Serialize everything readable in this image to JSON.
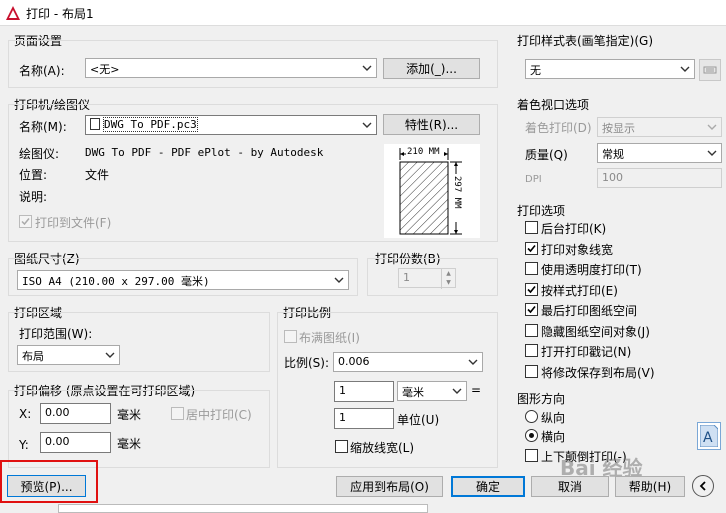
{
  "window": {
    "title": "打印 - 布局1"
  },
  "page_setup": {
    "group_label": "页面设置",
    "name_label": "名称(A):",
    "name_value": "<无>",
    "add_button": "添加(_)..."
  },
  "printer": {
    "group_label": "打印机/绘图仪",
    "name_label": "名称(M):",
    "name_value": "DWG To PDF.pc3",
    "properties_button": "特性(R)...",
    "plotter_label": "绘图仪:",
    "plotter_value": "DWG To PDF - PDF ePlot - by Autodesk",
    "location_label": "位置:",
    "location_value": "文件",
    "description_label": "说明:",
    "print_to_file": "打印到文件(F)",
    "paper_width": "210 MM",
    "paper_height": "297 MM"
  },
  "paper_size": {
    "group_label": "图纸尺寸(Z)",
    "value": "ISO A4 (210.00 x 297.00 毫米)"
  },
  "copies": {
    "group_label": "打印份数(B)",
    "value": "1"
  },
  "plot_area": {
    "group_label": "打印区域",
    "range_label": "打印范围(W):",
    "range_value": "布局"
  },
  "plot_offset": {
    "group_label": "打印偏移 (原点设置在可打印区域)",
    "x_label": "X:",
    "x_value": "0.00",
    "x_unit": "毫米",
    "y_label": "Y:",
    "y_value": "0.00",
    "y_unit": "毫米",
    "center_plot": "居中打印(C)"
  },
  "plot_scale": {
    "group_label": "打印比例",
    "fit_paper": "布满图纸(I)",
    "scale_label": "比例(S):",
    "scale_value": "0.006",
    "value1": "1",
    "unit_value": "毫米",
    "equals": "=",
    "value2": "1",
    "unit_label": "单位(U)",
    "scale_lineweights": "缩放线宽(L)"
  },
  "plot_style_table": {
    "group_label": "打印样式表(画笔指定)(G)",
    "value": "无"
  },
  "shaded_viewport": {
    "group_label": "着色视口选项",
    "shade_plot_label": "着色打印(D)",
    "shade_plot_value": "按显示",
    "quality_label": "质量(Q)",
    "quality_value": "常规",
    "dpi_label": "DPI",
    "dpi_value": "100"
  },
  "plot_options": {
    "group_label": "打印选项",
    "items": [
      {
        "label": "后台打印(K)",
        "checked": false
      },
      {
        "label": "打印对象线宽",
        "checked": true
      },
      {
        "label": "使用透明度打印(T)",
        "checked": false
      },
      {
        "label": "按样式打印(E)",
        "checked": true
      },
      {
        "label": "最后打印图纸空间",
        "checked": true
      },
      {
        "label": "隐藏图纸空间对象(J)",
        "checked": false
      },
      {
        "label": "打开打印戳记(N)",
        "checked": false
      },
      {
        "label": "将修改保存到布局(V)",
        "checked": false
      }
    ]
  },
  "orientation": {
    "group_label": "图形方向",
    "portrait": "纵向",
    "landscape": "横向",
    "upside_down": "上下颠倒打印(-)",
    "selected": "landscape"
  },
  "footer": {
    "preview": "预览(P)...",
    "apply_to_layout": "应用到布局(O)",
    "ok": "确定",
    "cancel": "取消",
    "help": "帮助(H)"
  },
  "watermark": {
    "text": "Bai 经验"
  },
  "colors": {
    "highlight": "#e01010",
    "focus": "#0078d7"
  }
}
